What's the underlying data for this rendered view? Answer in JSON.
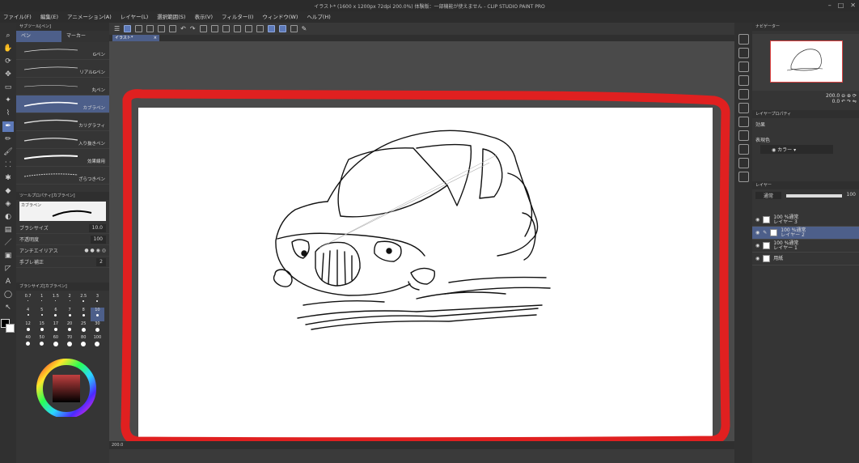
{
  "window": {
    "title": "イラスト* (1600 x 1200px 72dpi 200.0%) 体験版：一部機能が使えません - CLIP STUDIO PAINT PRO",
    "minimize": "–",
    "maximize": "□",
    "close": "✕"
  },
  "menu": [
    "ファイル(F)",
    "編集(E)",
    "アニメーション(A)",
    "レイヤー(L)",
    "選択範囲(S)",
    "表示(V)",
    "フィルター(I)",
    "ウィンドウ(W)",
    "ヘルプ(H)"
  ],
  "document_tab": {
    "label": "イラスト*",
    "close": "×"
  },
  "sub_tool": {
    "panel_title": "サブツール[ペン]",
    "tabs": [
      "ペン",
      "マーカー"
    ],
    "brushes": [
      "Gペン",
      "リアルGペン",
      "丸ペン",
      "カブラペン",
      "カリグラフィ",
      "入り抜きペン",
      "効果線用",
      "ざらつきペン"
    ],
    "active_index": 3
  },
  "tool_property": {
    "panel_title": "ツールプロパティ[カブラペン]",
    "preview_label": "カブラペン",
    "rows": [
      {
        "label": "ブラシサイズ",
        "value": "10.0"
      },
      {
        "label": "不透明度",
        "value": "100"
      },
      {
        "label": "アンチエイリアス",
        "value": ""
      },
      {
        "label": "手ブレ補正",
        "value": "2"
      }
    ]
  },
  "brush_size": {
    "panel_title": "ブラシサイズ[カブラペン]",
    "sizes": [
      "0.7",
      "1",
      "1.5",
      "2",
      "2.5",
      "3",
      "4",
      "5",
      "6",
      "7",
      "8",
      "10",
      "12",
      "15",
      "17",
      "20",
      "25",
      "30",
      "40",
      "50",
      "60",
      "70",
      "80",
      "100"
    ],
    "active_index": 11
  },
  "color": {
    "fg": "#000000",
    "bg": "#ffffff"
  },
  "zoom_status": "200.0",
  "navigator": {
    "panel_title": "ナビゲーター",
    "zoom": "200.0",
    "rotation": "0.0"
  },
  "layer_property": {
    "panel_title": "レイヤープロパティ",
    "effect_label": "効果",
    "expression_label": "表現色",
    "expression_value": "カラー"
  },
  "layers": {
    "panel_title": "レイヤー",
    "blend_mode": "通常",
    "opacity": "100",
    "items": [
      {
        "line1": "100 %通常",
        "line2": "レイヤー 3"
      },
      {
        "line1": "100 %通常",
        "line2": "レイヤー 2"
      },
      {
        "line1": "100 %通常",
        "line2": "レイヤー 1"
      },
      {
        "line1": "",
        "line2": "用紙"
      }
    ],
    "active_index": 1
  }
}
